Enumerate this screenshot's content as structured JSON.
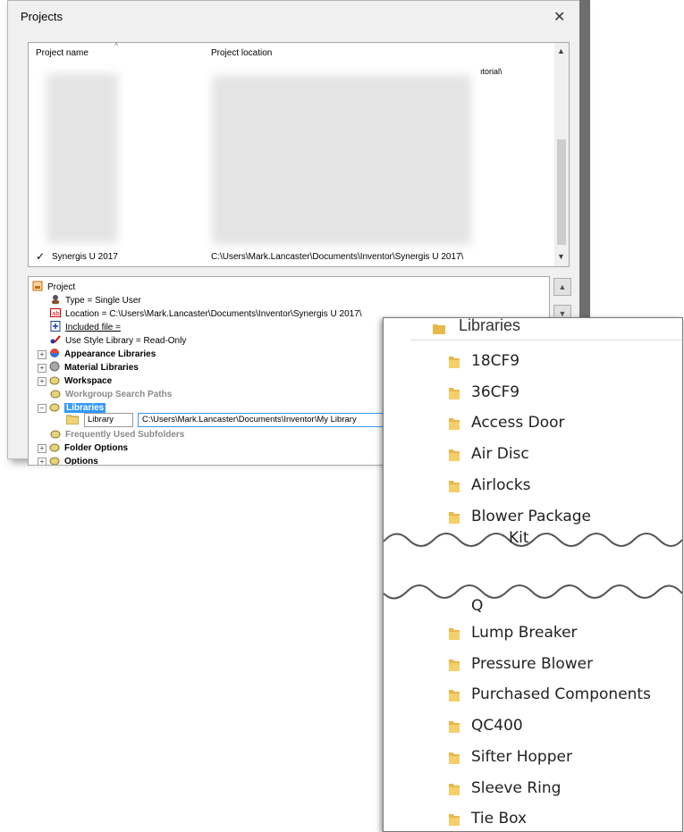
{
  "dialog": {
    "title": "Projects",
    "close_glyph": "✕",
    "columns": {
      "name": "Project name",
      "location": "Project location",
      "sort_glyph": "^"
    },
    "partial_location": "ıtorial\\",
    "active_project": {
      "check": "✓",
      "name": "Synergis U 2017",
      "location": "C:\\Users\\Mark.Lancaster\\Documents\\Inventor\\Synergis U 2017\\"
    },
    "scroll_up": "▲",
    "scroll_down": "▼"
  },
  "tree": {
    "root": "Project",
    "type": "Type = Single User",
    "location": "Location = C:\\Users\\Mark.Lancaster\\Documents\\Inventor\\Synergis U 2017\\",
    "included_file": "Included file =",
    "style_library": "Use Style Library = Read-Only",
    "appearance": "Appearance Libraries",
    "material": "Material Libraries",
    "workspace": "Workspace",
    "workgroup": "Workgroup Search Paths",
    "libraries": "Libraries",
    "library_name": "Library",
    "library_path": "C:\\Users\\Mark.Lancaster\\Documents\\Inventor\\My Library",
    "frequent": "Frequently Used Subfolders",
    "folder_options": "Folder Options",
    "options": "Options",
    "expand_plus": "+",
    "expand_minus": "−"
  },
  "folders": {
    "header": "Libraries",
    "items": [
      "18CF9",
      "36CF9",
      "Access Door",
      "Air Disc",
      "Airlocks",
      "Blower Package"
    ],
    "cut_items": [
      "Kit",
      "Q"
    ],
    "items2": [
      "Lump Breaker",
      "Pressure Blower",
      "Purchased Components",
      "QC400",
      "Sifter Hopper",
      "Sleeve Ring",
      "Tie Box"
    ],
    "folder_color": "#e8b84a"
  }
}
